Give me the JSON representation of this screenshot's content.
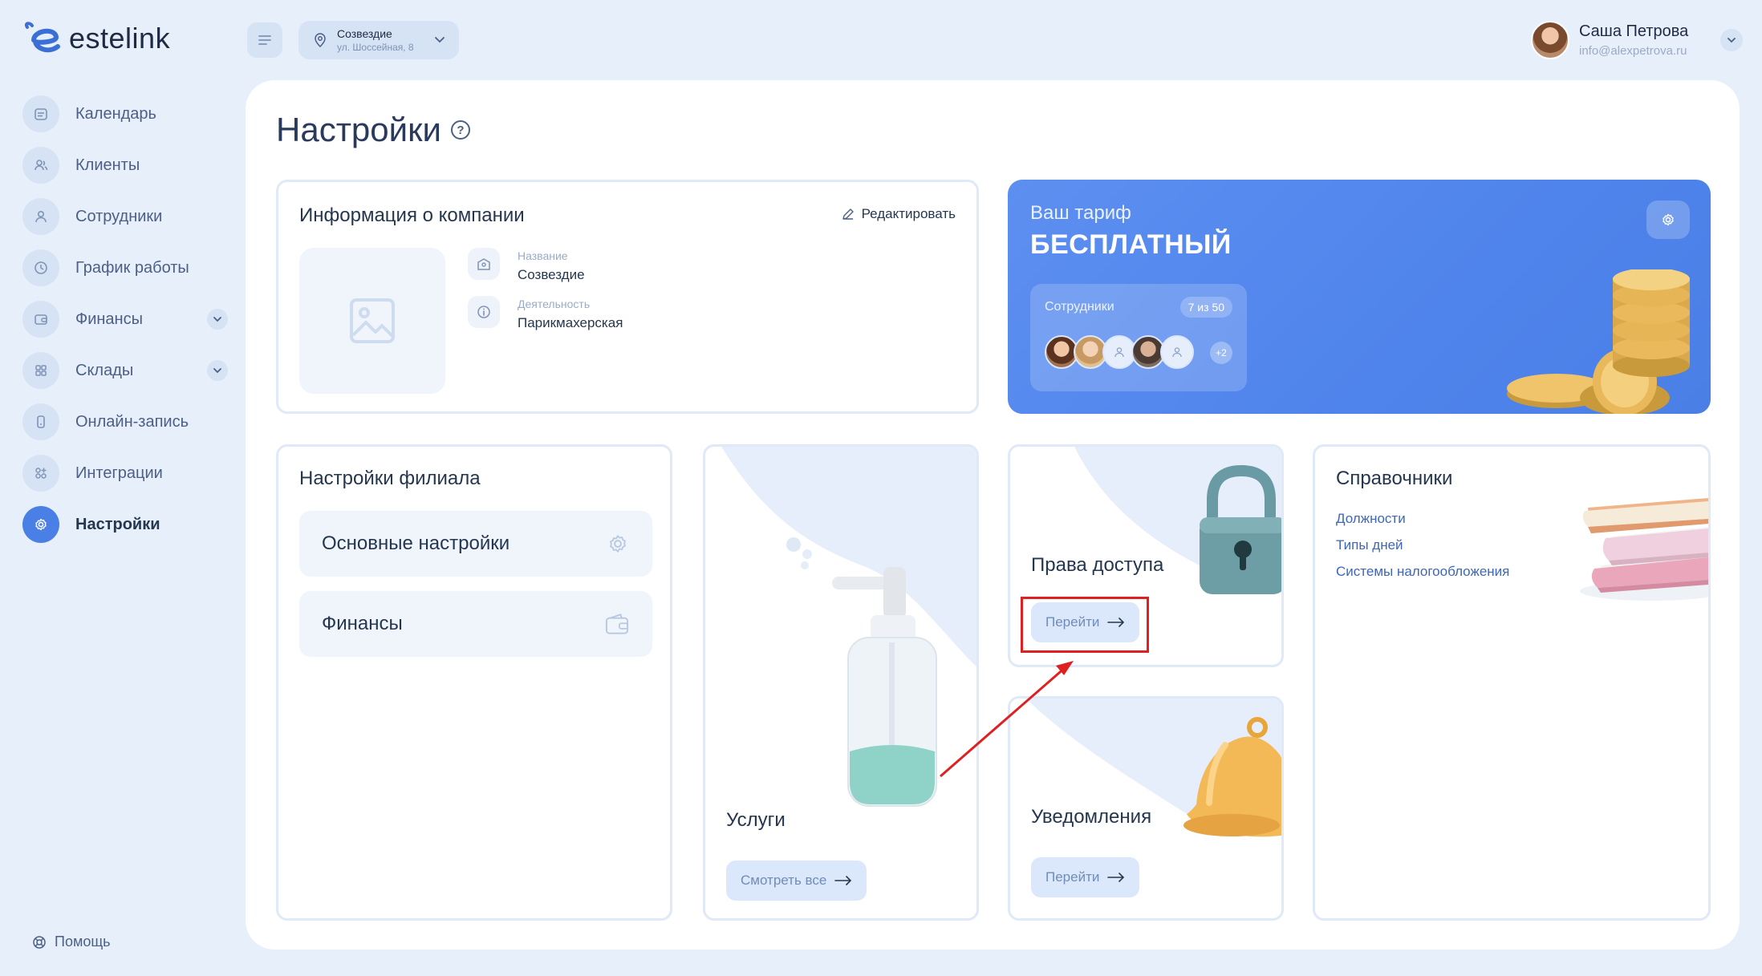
{
  "brand": {
    "name": "estelink"
  },
  "sidebar": {
    "items": [
      {
        "label": "Календарь",
        "icon": "calendar-icon"
      },
      {
        "label": "Клиенты",
        "icon": "clients-icon"
      },
      {
        "label": "Сотрудники",
        "icon": "user-icon"
      },
      {
        "label": "График работы",
        "icon": "clock-icon"
      },
      {
        "label": "Финансы",
        "icon": "wallet-icon",
        "expandable": true
      },
      {
        "label": "Склады",
        "icon": "boxes-icon",
        "expandable": true
      },
      {
        "label": "Онлайн-запись",
        "icon": "phone-icon"
      },
      {
        "label": "Интеграции",
        "icon": "grid-plus-icon"
      },
      {
        "label": "Настройки",
        "icon": "gear-icon",
        "active": true
      }
    ],
    "help_label": "Помощь"
  },
  "topbar": {
    "branch_name": "Созвездие",
    "branch_address": "ул. Шоссейная, 8",
    "user_name": "Саша Петрова",
    "user_email": "info@alexpetrova.ru"
  },
  "page": {
    "title": "Настройки"
  },
  "company": {
    "title": "Информация о компании",
    "edit_label": "Редактировать",
    "name_label": "Название",
    "name_value": "Созвездие",
    "activity_label": "Деятельность",
    "activity_value": "Парикмахерская"
  },
  "tariff": {
    "caption": "Ваш тариф",
    "name": "БЕСПЛАТНЫЙ",
    "staff_label": "Сотрудники",
    "staff_count": "7 из 50",
    "more_count": "+2"
  },
  "branch_settings": {
    "title": "Настройки филиала",
    "items": [
      {
        "label": "Основные настройки"
      },
      {
        "label": "Финансы"
      }
    ]
  },
  "services": {
    "title": "Услуги",
    "button": "Смотреть все"
  },
  "access": {
    "title": "Права доступа",
    "button": "Перейти"
  },
  "notifications": {
    "title": "Уведомления",
    "button": "Перейти"
  },
  "references": {
    "title": "Справочники",
    "links": [
      "Должности",
      "Типы дней",
      "Системы налогообложения"
    ]
  },
  "colors": {
    "accent": "#4a7fe6",
    "background": "#e6effa",
    "annotation": "#e02020"
  }
}
